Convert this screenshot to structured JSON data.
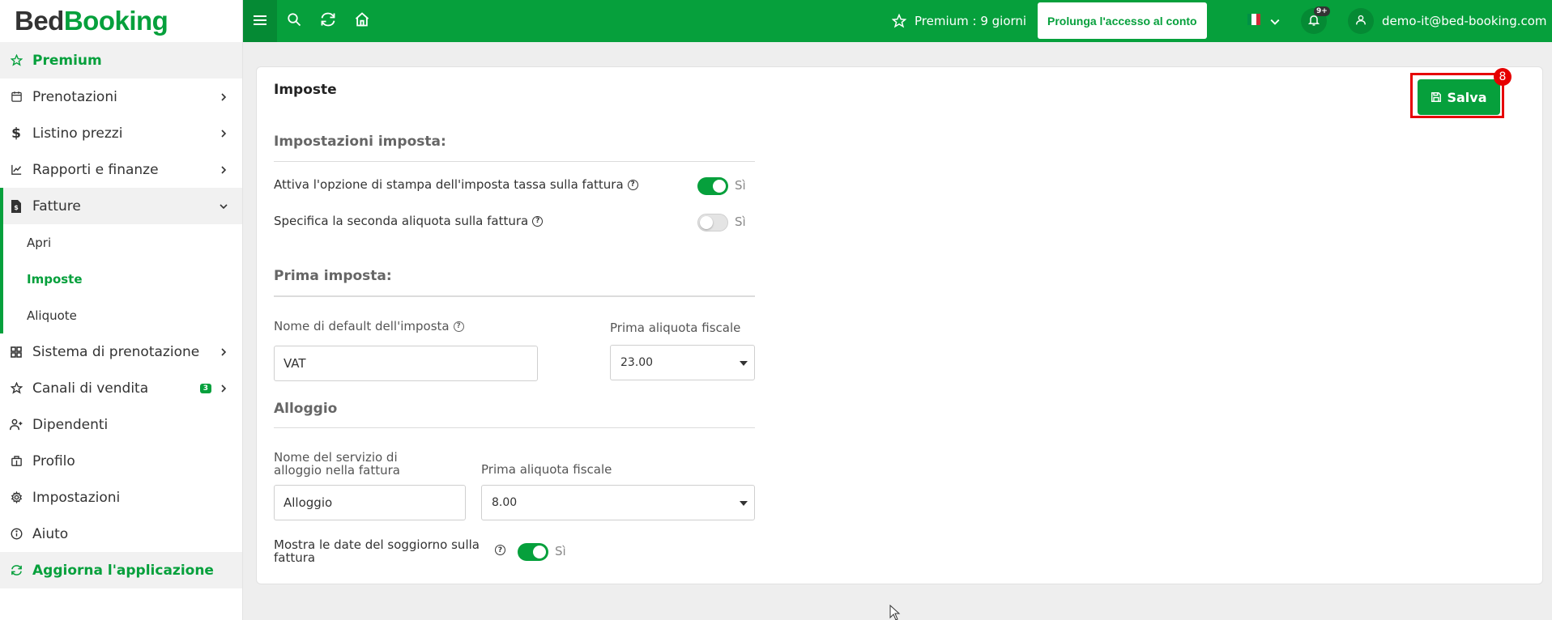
{
  "app": {
    "logo_part1": "Bed",
    "logo_part2": "Booking"
  },
  "topbar": {
    "premium_label": "Premium : ",
    "premium_days": "9 giorni",
    "extend_button": "Prolunga l'accesso al conto",
    "notifications_badge": "9+",
    "user_email": "demo-it@bed-booking.com"
  },
  "sidebar": {
    "premium": "Premium",
    "items": [
      {
        "label": "Prenotazioni"
      },
      {
        "label": "Listino prezzi"
      },
      {
        "label": "Rapporti e finanze"
      },
      {
        "label": "Fatture"
      },
      {
        "label": "Sistema di prenotazione"
      },
      {
        "label": "Canali di vendita",
        "badge": "3"
      },
      {
        "label": "Dipendenti"
      },
      {
        "label": "Profilo"
      },
      {
        "label": "Impostazioni"
      },
      {
        "label": "Aiuto"
      }
    ],
    "sub_items": [
      {
        "label": "Apri"
      },
      {
        "label": "Imposte"
      },
      {
        "label": "Aliquote"
      }
    ],
    "update": "Aggiorna l'applicazione"
  },
  "main": {
    "title": "Imposte",
    "save_button": "Salva",
    "save_badge": "8",
    "tax_settings": {
      "heading": "Impostazioni imposta:",
      "print_tax_label": "Attiva l'opzione di stampa dell'imposta tassa sulla fattura",
      "print_tax_on": true,
      "print_tax_text": "Sì",
      "second_rate_label": "Specifica la seconda aliquota sulla fattura",
      "second_rate_on": false,
      "second_rate_text": "Sì"
    },
    "first_tax": {
      "heading": "Prima imposta:",
      "default_name_label": "Nome di default dell'imposta",
      "default_name_value": "VAT",
      "rate_label": "Prima aliquota fiscale",
      "rate_value": "23.00"
    },
    "lodging": {
      "heading": "Alloggio",
      "service_name_label": "Nome del servizio di alloggio nella fattura",
      "service_name_value": "Alloggio",
      "rate_label": "Prima aliquota fiscale",
      "rate_value": "8.00",
      "show_dates_label": "Mostra le date del soggiorno sulla fattura",
      "show_dates_on": true,
      "show_dates_text": "Sì"
    }
  },
  "colors": {
    "brand_green": "#06a03c",
    "highlight_red": "#e60000"
  }
}
